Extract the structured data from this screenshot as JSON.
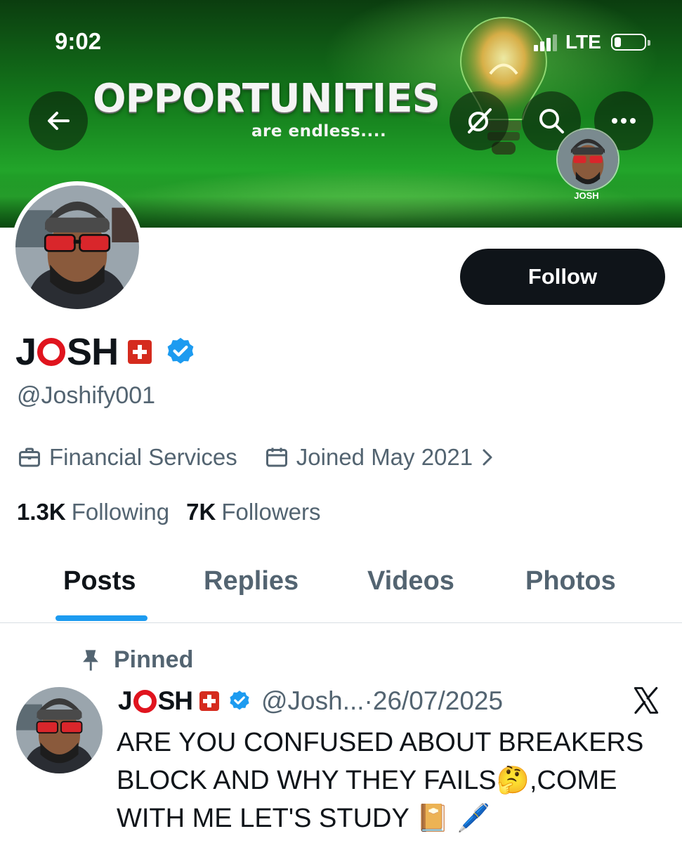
{
  "status_bar": {
    "time": "9:02",
    "network": "LTE"
  },
  "banner": {
    "title": "OPPORTUNITIES",
    "subtitle": "are endless....",
    "mini_avatar_label": "JOSH"
  },
  "header_buttons": [
    "back-icon",
    "grok-icon",
    "search-icon",
    "more-icon"
  ],
  "profile": {
    "name_part1": "J",
    "name_part2": "SH",
    "handle": "@Joshify001",
    "category": "Financial Services",
    "joined": "Joined May 2021",
    "following_count": "1.3K",
    "following_label": "Following",
    "followers_count": "7K",
    "followers_label": "Followers",
    "follow_label": "Follow"
  },
  "tabs": [
    {
      "label": "Posts",
      "active": true
    },
    {
      "label": "Replies"
    },
    {
      "label": "Videos"
    },
    {
      "label": "Photos"
    }
  ],
  "post": {
    "pinned_label": "Pinned",
    "name_part1": "J",
    "name_part2": "SH",
    "handle": "@Josh...",
    "separator": "·",
    "date": "26/07/2025",
    "line1": "ARE YOU CONFUSED ABOUT BREAKERS",
    "line2_a": "BLOCK AND WHY THEY FAILS",
    "emoji_thinking": "🤔",
    "line2_b": ",COME",
    "line3": "WITH ME LET'S STUDY",
    "emoji_notebook": "📔",
    "emoji_pen": "🖊️"
  },
  "colors": {
    "accent": "#1d9bf0",
    "text": "#0f1419",
    "muted": "#536471",
    "brand_red": "#e0141e"
  }
}
